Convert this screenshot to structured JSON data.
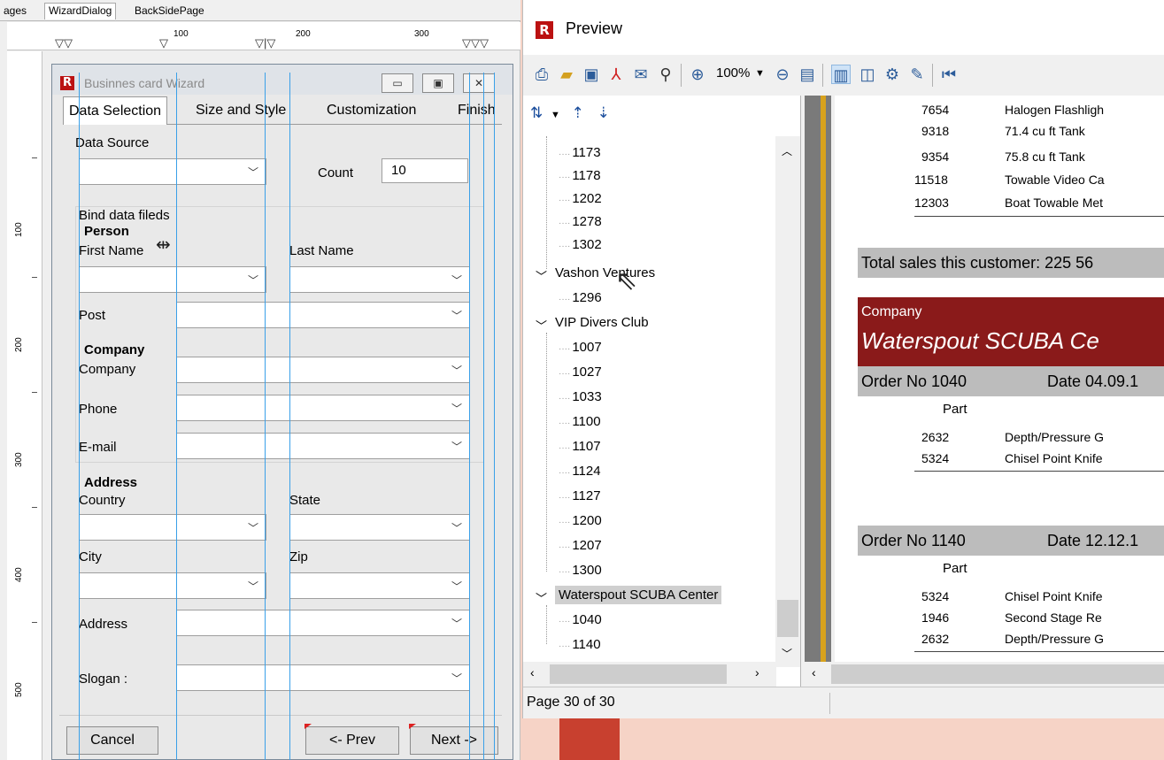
{
  "designer": {
    "page_tabs": [
      "ages",
      "WizardDialog",
      "BackSidePage"
    ],
    "ruler_top": [
      "100",
      "200",
      "300"
    ],
    "ruler_left": [
      "100",
      "200",
      "300",
      "400",
      "500"
    ],
    "wizard": {
      "title": "Businnes card Wizard",
      "tabs": [
        "Data Selection",
        "Size and Style",
        "Customization",
        "Finish"
      ],
      "data_source_label": "Data Source",
      "count_label": "Count",
      "count_value": "10",
      "bind_label": "Bind data fileds",
      "person_label": "Person",
      "first_name_label": "First Name",
      "last_name_label": "Last Name",
      "post_label": "Post",
      "company_group_label": "Company",
      "company_label": "Company",
      "phone_label": "Phone",
      "email_label": "E-mail",
      "address_group_label": "Address",
      "country_label": "Country",
      "state_label": "State",
      "city_label": "City",
      "zip_label": "Zip",
      "address_label": "Address",
      "slogan_label": "Slogan :",
      "cancel": "Cancel",
      "prev": "<- Prev",
      "next": "Next ->"
    }
  },
  "preview": {
    "title": "Preview",
    "zoom": "100%",
    "tree": {
      "leaves_top": [
        "1173",
        "1178",
        "1202",
        "1278",
        "1302"
      ],
      "customer_vashon": "Vashon Ventures",
      "vashon_leaves": [
        "1296"
      ],
      "customer_vip": "VIP Divers Club",
      "vip_leaves": [
        "1007",
        "1027",
        "1033",
        "1100",
        "1107",
        "1124",
        "1127",
        "1200",
        "1207",
        "1300"
      ],
      "customer_waterspout": "Waterspout SCUBA Center",
      "waterspout_leaves": [
        "1040",
        "1140"
      ]
    },
    "report": {
      "top_rows": [
        {
          "part": "7654",
          "desc": "Halogen Flashligh"
        },
        {
          "part": "9318",
          "desc": "71.4 cu ft Tank"
        },
        {
          "part": "9354",
          "desc": "75.8 cu ft Tank"
        },
        {
          "part": "11518",
          "desc": "Towable Video Ca"
        },
        {
          "part": "12303",
          "desc": "Boat Towable Met"
        }
      ],
      "total": "Total sales this customer: 225 56",
      "company_caption": "Company",
      "company_name": "Waterspout SCUBA Ce",
      "order1": {
        "no": "Order No 1040",
        "date": "Date 04.09.1",
        "part_label": "Part",
        "rows": [
          {
            "part": "2632",
            "desc": "Depth/Pressure G"
          },
          {
            "part": "5324",
            "desc": "Chisel Point Knife"
          }
        ]
      },
      "order2": {
        "no": "Order No 1140",
        "date": "Date 12.12.1",
        "part_label": "Part",
        "rows": [
          {
            "part": "5324",
            "desc": "Chisel Point Knife"
          },
          {
            "part": "1946",
            "desc": "Second Stage Re"
          },
          {
            "part": "2632",
            "desc": "Depth/Pressure G"
          }
        ]
      }
    },
    "status": "Page 30 of 30"
  }
}
